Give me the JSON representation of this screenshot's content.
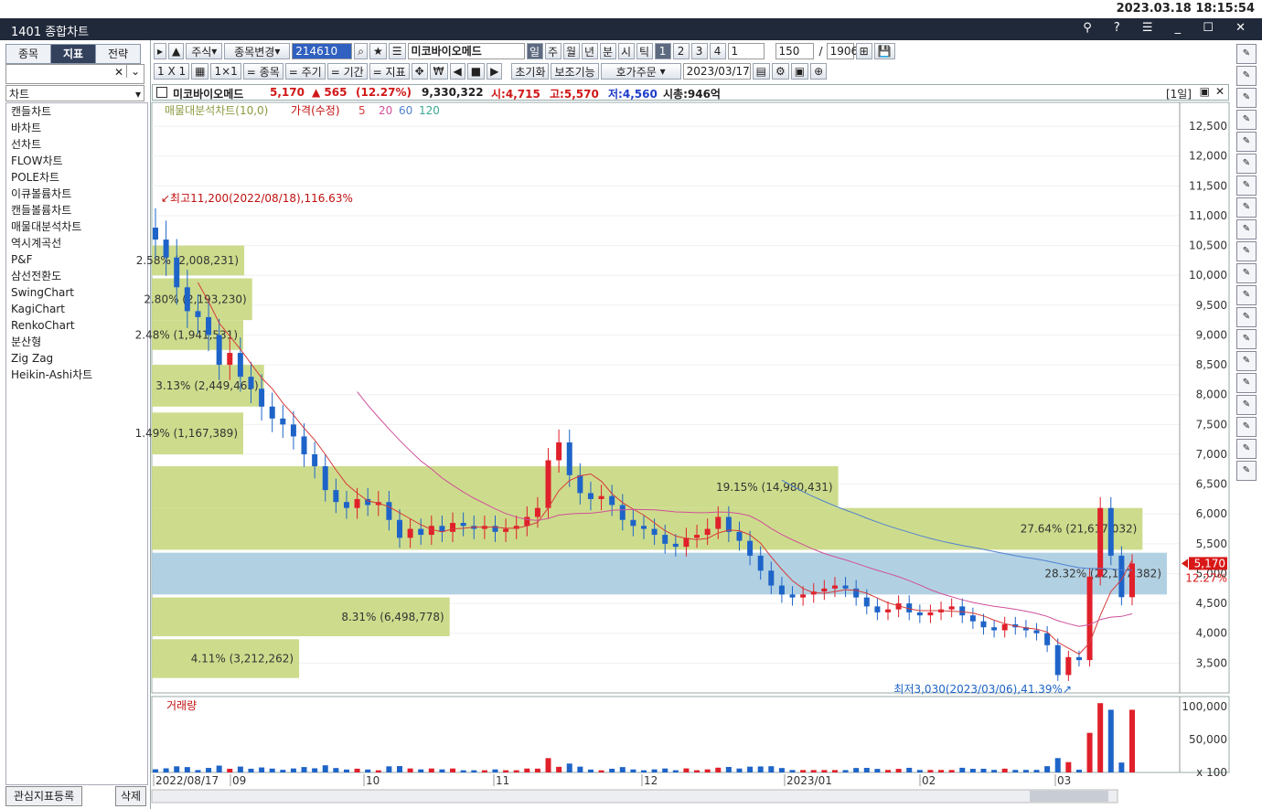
{
  "clock": "2023.03.18 18:15:54",
  "window": {
    "title": "1401 종합차트",
    "controls": "⚲ ? ☰ _ ☐ ✕"
  },
  "left": {
    "tabs": [
      "종목",
      "지표",
      "전략"
    ],
    "search_value": "",
    "category": "차트",
    "items": [
      "캔들차트",
      "바차트",
      "선차트",
      "FLOW차트",
      "POLE차트",
      "이큐볼륨차트",
      "캔들볼륨차트",
      "매물대분석차트",
      "역시계곡선",
      "P&F",
      "삼선전환도",
      "SwingChart",
      "KagiChart",
      "RenkoChart",
      "분산형",
      "Zig Zag",
      "Heikin-Ashi차트"
    ],
    "register_button": "관심지표등록",
    "delete_button": "삭제"
  },
  "toolbar1": {
    "market": "주식",
    "change": "종목변경",
    "code": "214610",
    "name": "미코바이오메드",
    "periods": [
      "일",
      "주",
      "월",
      "년",
      "분",
      "시",
      "틱"
    ],
    "nums": [
      "1",
      "2",
      "3",
      "4"
    ],
    "interval": "1",
    "count": "150",
    "total": "1906"
  },
  "toolbar2": {
    "layout": "1 X 1",
    "buttons": [
      "= 종목",
      "= 주기",
      "= 기간",
      "= 지표"
    ],
    "reset": "초기화",
    "aux": "보조기능",
    "order": "호가주문",
    "date": "2023/03/17"
  },
  "info": {
    "name": "미코바이오메드",
    "price": "5,170",
    "change": "▲ 565",
    "rate": "(12.27%)",
    "volume": "9,330,322",
    "open": "시:4,715",
    "high": "고:5,570",
    "low": "저:4,560",
    "mcap": "시총:946억",
    "period": "[1일]"
  },
  "legend": {
    "vp": "매물대분석차트(10,0)",
    "price": "가격(수정)",
    "ma": [
      "5",
      "20",
      "60",
      "120"
    ],
    "volume": "거래량"
  },
  "annotations": {
    "high": "최고11,200(2022/08/18),116.63%",
    "low": "최저3,030(2023/03/06),41.39%"
  },
  "colors": {
    "up": "#e0202a",
    "down": "#1e64c8",
    "ma5": "#d63a3a",
    "ma20": "#d0509a",
    "ma60": "#5080d0",
    "ma120": "#3aa890",
    "vp": "#c8d880",
    "vp_hl": "#a8cce0"
  },
  "chart_data": {
    "type": "candlestick",
    "price_axis": {
      "ticks": [
        3500,
        4000,
        4500,
        5000,
        5500,
        6000,
        6500,
        7000,
        7500,
        8000,
        8500,
        9000,
        9500,
        10000,
        10500,
        11000,
        11500,
        12000,
        12500
      ],
      "labels": [
        "3,500",
        "4,000",
        "4,500",
        "5,000",
        "5,500",
        "6,000",
        "6,500",
        "7,000",
        "7,500",
        "8,000",
        "8,500",
        "9,000",
        "9,500",
        "10,000",
        "10,500",
        "11,000",
        "11,500",
        "12,000",
        "12,500"
      ],
      "current": "5,170",
      "current_rate": "12.27%"
    },
    "volume_axis": {
      "ticks": [
        100,
        50000,
        100000
      ],
      "labels": [
        "x 100",
        "50,000",
        "100,000"
      ]
    },
    "x_labels": [
      "2022/08/17",
      "09",
      "10",
      "11",
      "12",
      "2023/01",
      "02",
      "03"
    ],
    "volume_profile": [
      {
        "label": "2.58% (2,008,231)",
        "low": 10000,
        "high": 10500
      },
      {
        "label": "2.80% (2,193,230)",
        "low": 9250,
        "high": 9950
      },
      {
        "label": "2.48% (1,941,531)",
        "low": 8750,
        "high": 9250
      },
      {
        "label": "3.13% (2,449,463)",
        "low": 7800,
        "high": 8500
      },
      {
        "label": "1.49% (1,167,389)",
        "low": 7000,
        "high": 7700
      },
      {
        "label": "19.15% (14,980,431)",
        "low": 6100,
        "high": 6800
      },
      {
        "label": "27.64% (21,617,032)",
        "low": 5400,
        "high": 6100
      },
      {
        "label": "28.32% (22,147,382)",
        "low": 4650,
        "high": 5350
      },
      {
        "label": "8.31% (6,498,778)",
        "low": 3950,
        "high": 4600
      },
      {
        "label": "4.11% (3,212,262)",
        "low": 3250,
        "high": 3900
      }
    ],
    "close": [
      10600,
      10300,
      9800,
      9400,
      9300,
      9000,
      8500,
      8700,
      8300,
      8100,
      7800,
      7600,
      7500,
      7300,
      7000,
      6800,
      6400,
      6200,
      6100,
      6250,
      6150,
      6200,
      5900,
      5600,
      5750,
      5650,
      5800,
      5700,
      5850,
      5800,
      5750,
      5800,
      5700,
      5750,
      5800,
      5950,
      6100,
      6900,
      7200,
      6650,
      6350,
      6250,
      6300,
      6150,
      5900,
      5800,
      5750,
      5650,
      5500,
      5450,
      5600,
      5650,
      5750,
      5950,
      5700,
      5550,
      5300,
      5050,
      4800,
      4650,
      4600,
      4650,
      4700,
      4750,
      4800,
      4750,
      4600,
      4450,
      4350,
      4400,
      4500,
      4350,
      4300,
      4350,
      4400,
      4450,
      4300,
      4200,
      4100,
      4050,
      4150,
      4100,
      4050,
      4000,
      3800,
      3300,
      3600,
      3550,
      4950,
      6100,
      5300,
      4605,
      5170
    ]
  }
}
